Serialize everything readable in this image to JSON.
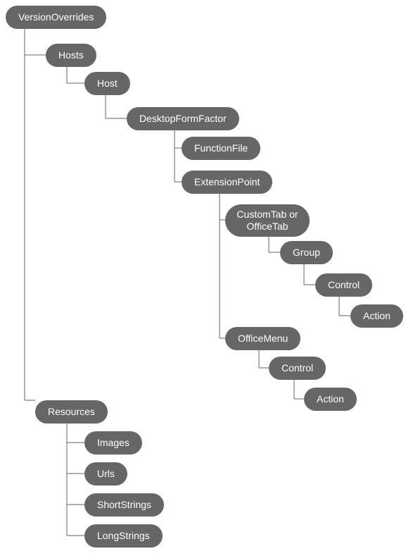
{
  "nodes": {
    "versionOverrides": "VersionOverrides",
    "hosts": "Hosts",
    "host": "Host",
    "desktopFormFactor": "DesktopFormFactor",
    "functionFile": "FunctionFile",
    "extensionPoint": "ExtensionPoint",
    "customOrOfficeTab": "CustomTab or OfficeTab",
    "group": "Group",
    "control1": "Control",
    "action1": "Action",
    "officeMenu": "OfficeMenu",
    "control2": "Control",
    "action2": "Action",
    "resources": "Resources",
    "images": "Images",
    "urls": "Urls",
    "shortStrings": "ShortStrings",
    "longStrings": "LongStrings"
  }
}
